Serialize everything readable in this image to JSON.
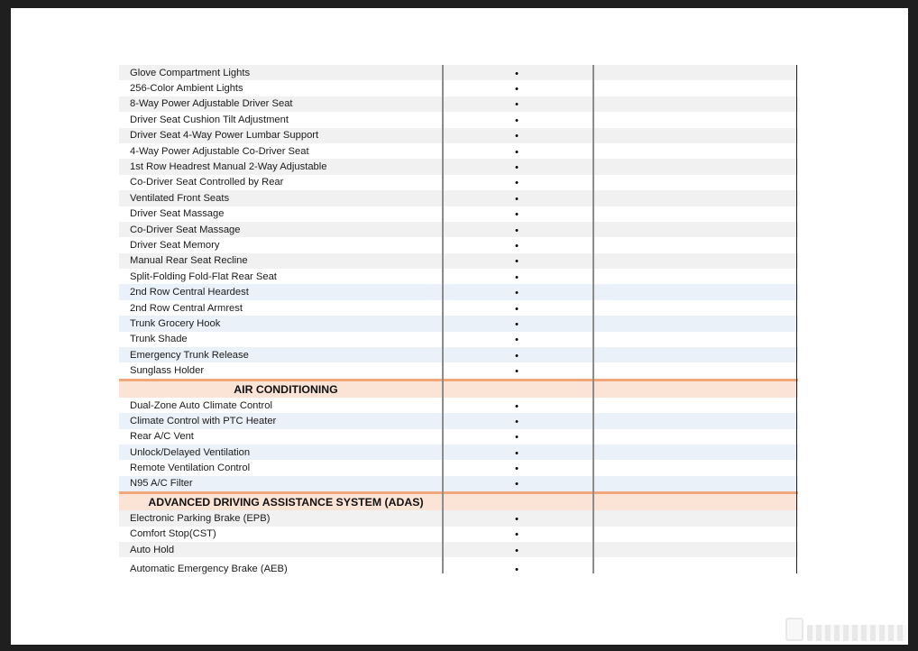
{
  "bullet": "•",
  "sections": [
    {
      "title": "",
      "rows": [
        {
          "label": "Glove Compartment Lights",
          "mark": "•",
          "tone": "alt-gray"
        },
        {
          "label": "256-Color Ambient Lights",
          "mark": "•",
          "tone": "white"
        },
        {
          "label": "8-Way Power Adjustable Driver Seat",
          "mark": "•",
          "tone": "alt-gray"
        },
        {
          "label": "Driver Seat Cushion Tilt Adjustment",
          "mark": "•",
          "tone": "white"
        },
        {
          "label": "Driver Seat 4-Way Power Lumbar Support",
          "mark": "•",
          "tone": "alt-gray"
        },
        {
          "label": "4-Way Power Adjustable Co-Driver Seat",
          "mark": "•",
          "tone": "white"
        },
        {
          "label": "1st Row Headrest Manual 2-Way Adjustable",
          "mark": "•",
          "tone": "alt-gray"
        },
        {
          "label": "Co-Driver Seat Controlled by Rear",
          "mark": "•",
          "tone": "white"
        },
        {
          "label": "Ventilated Front Seats",
          "mark": "•",
          "tone": "alt-gray"
        },
        {
          "label": "Driver Seat Massage",
          "mark": "•",
          "tone": "white"
        },
        {
          "label": "Co-Driver Seat Massage",
          "mark": "•",
          "tone": "alt-gray"
        },
        {
          "label": "Driver Seat Memory",
          "mark": "•",
          "tone": "white"
        },
        {
          "label": "Manual Rear Seat Recline",
          "mark": "•",
          "tone": "alt-gray"
        },
        {
          "label": "Split-Folding Fold-Flat Rear Seat",
          "mark": "•",
          "tone": "white"
        },
        {
          "label": "2nd Row Central Heardest",
          "mark": "•",
          "tone": "alt-blue"
        },
        {
          "label": "2nd Row Central Armrest",
          "mark": "•",
          "tone": "white"
        },
        {
          "label": "Trunk Grocery Hook",
          "mark": "•",
          "tone": "alt-blue"
        },
        {
          "label": "Trunk Shade",
          "mark": "•",
          "tone": "white"
        },
        {
          "label": "Emergency Trunk Release",
          "mark": "•",
          "tone": "alt-blue"
        },
        {
          "label": "Sunglass Holder",
          "mark": "•",
          "tone": "white"
        }
      ]
    },
    {
      "title": "AIR CONDITIONING",
      "rows": [
        {
          "label": "Dual-Zone Auto Climate Control",
          "mark": "•",
          "tone": "white"
        },
        {
          "label": "Climate Control with PTC Heater",
          "mark": "•",
          "tone": "alt-blue"
        },
        {
          "label": "Rear A/C Vent",
          "mark": "•",
          "tone": "white"
        },
        {
          "label": "Unlock/Delayed Ventilation",
          "mark": "•",
          "tone": "alt-blue"
        },
        {
          "label": "Remote Ventilation Control",
          "mark": "•",
          "tone": "white"
        },
        {
          "label": "N95 A/C Filter",
          "mark": "•",
          "tone": "alt-blue"
        }
      ]
    },
    {
      "title": "ADVANCED DRIVING ASSISTANCE SYSTEM (ADAS)",
      "rows": [
        {
          "label": "Electronic Parking Brake (EPB)",
          "mark": "•",
          "tone": "alt-gray"
        },
        {
          "label": "Comfort Stop(CST)",
          "mark": "•",
          "tone": "white"
        },
        {
          "label": "Auto Hold",
          "mark": "•",
          "tone": "alt-gray"
        },
        {
          "label": "Automatic Emergency Brake (AEB)",
          "mark": "•",
          "tone": "white"
        }
      ]
    }
  ],
  "colors": {
    "section_bg": "#fbe3d6",
    "section_border": "#f0a779",
    "row_gray": "#f1f1f1",
    "row_blue": "#eaf1f9",
    "column_line": "#8c8c8c"
  }
}
